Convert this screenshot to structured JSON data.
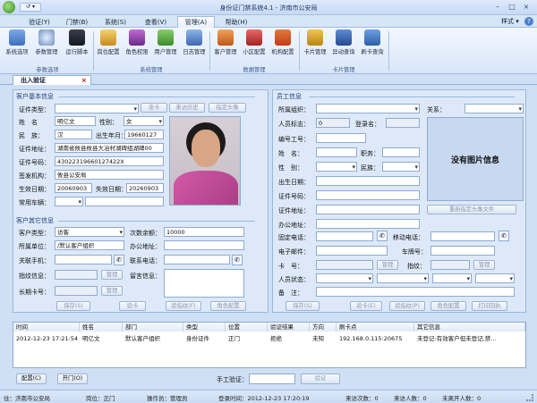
{
  "titlebar": {
    "title": "身份证门禁系统4.1 - 济南市公安局",
    "style_label": "样式"
  },
  "tabs": [
    "验证(Y)",
    "门禁(B)",
    "系统(S)",
    "查看(V)",
    "管理(A)",
    "帮助(H)"
  ],
  "ribbon": {
    "groups": [
      {
        "name": "参数选项",
        "buttons": [
          "系统选项",
          "参数管理",
          "运行脚本"
        ]
      },
      {
        "name": "系统管理",
        "buttons": [
          "岗位配置",
          "角色权限",
          "用户管理",
          "日志管理"
        ]
      },
      {
        "name": "数据管理",
        "buttons": [
          "客户管理",
          "小区配置",
          "机构配置"
        ]
      },
      {
        "name": "卡片管理",
        "buttons": [
          "卡片管理",
          "异动查询",
          "刷卡查询"
        ]
      }
    ]
  },
  "doc_tab": "出入验证",
  "client_basic": {
    "section": "客户基本信息",
    "id_type_label": "证件类型：",
    "read_card": "读卡",
    "visit_history": "来访历史",
    "specify_avatar": "指定头像",
    "name_label": "姓　名",
    "name": "明亿文",
    "gender_label": "性别：",
    "gender": "女",
    "ethnic_label": "民　族：",
    "ethnic": "汉",
    "birth_label": "出生年月：",
    "birth": "19660127",
    "address_label": "证件地址：",
    "address": "湖南省攸县攸县大冶村湖碑组湖碑00",
    "id_number_label": "证件号码：",
    "id_number": "43022319660127422X",
    "issuer_label": "签发机构：",
    "issuer": "攸县公安局",
    "valid_from_label": "生效日期：",
    "valid_from": "20060903",
    "valid_to_label": "失效日期：",
    "valid_to": "20260903",
    "phone_label": "常用车辆："
  },
  "client_other": {
    "section": "客户其它信息",
    "client_type_label": "客户类型：",
    "client_type": "访客",
    "visits_label": "次数余额：",
    "visits": "10000",
    "unit_label": "所属单位：",
    "unit": "/默认客户组织",
    "office_addr_label": "办公地址：",
    "contact_phone_label": "关联手机：",
    "contact_tel_label": "联系电话：",
    "fingerprint_label": "指纹信息：",
    "manage1": "管理",
    "message_label": "留言信息：",
    "long_card_label": "长期卡号：",
    "manage2": "管理",
    "save": "保存(S)",
    "verify_card": "验卡",
    "verify_fp": "验指纹(F)",
    "role_config": "角色配置"
  },
  "staff": {
    "section": "员工信息",
    "org_label": "所属组织：",
    "relation_label": "关系：",
    "id_label": "人员标志：",
    "id_value": "0",
    "login_label": "登录名：",
    "emp_no_label": "编号工号：",
    "name_label": "姓　名：",
    "position_label": "职务：",
    "gender_label": "性　别：",
    "ethnic_label": "民族：",
    "birth_label": "出生日期：",
    "id_number_label": "证件号码：",
    "address_label": "证件地址：",
    "office_label": "办公地址：",
    "no_photo": "没有图片信息",
    "reset_avatar": "重新指定头像文件",
    "fixed_tel_label": "固定电话：",
    "mobile_label": "移动电话：",
    "email_label": "电子邮件：",
    "plate_label": "车牌号：",
    "card_label": "卡　号：",
    "manage_card": "管理",
    "fingerprint_label": "指纹：",
    "manage_fp": "管理",
    "status_label": "人员状态：",
    "remark_label": "备　注：",
    "save": "保存(S)",
    "verify_card": "验卡(E)",
    "verify_fp": "验指纹(P)",
    "role_config": "角色配置",
    "print_slip": "打印回执"
  },
  "records": {
    "columns": [
      "时间",
      "姓名",
      "部门",
      "类型",
      "位置",
      "验证结果",
      "方向",
      "刷卡点",
      "其它信息"
    ],
    "rows": [
      [
        "2012-12-23 17:21:54",
        "明亿文",
        "默认客户组织",
        "身份证件",
        "正门",
        "拒绝",
        "未知",
        "192.168.0.115:20675",
        "未登记:有效客户但未登记,禁..."
      ]
    ]
  },
  "bottom": {
    "config": "配置(C)",
    "open_door": "开门(O)",
    "manual_label": "手工验证：",
    "verify": "验证"
  },
  "statusbar": {
    "station": "住：济南市公安局",
    "post": "岗位：正门",
    "operator": "操作员：管理员",
    "login_time": "登录时间：2012-12-23 17:20:19",
    "visits": "来访次数：0",
    "visitors": "来访人数：0",
    "not_left": "未离开人数：0"
  }
}
